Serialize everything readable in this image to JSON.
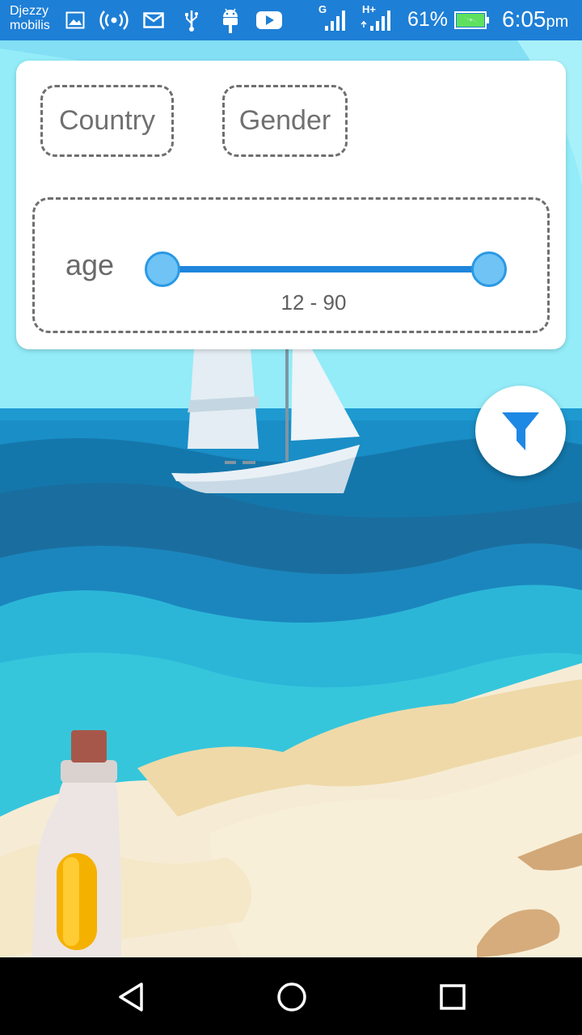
{
  "status_bar": {
    "carrier_line1": "Djezzy",
    "carrier_line2": "mobilis",
    "icons": [
      "image-icon",
      "hotspot-icon",
      "mail-icon",
      "usb-icon",
      "android-icon",
      "youtube-icon",
      "signal-g-icon",
      "signal-hplus-icon",
      "battery-charging-icon"
    ],
    "signal1_label": "G",
    "signal2_label": "H+",
    "battery_percent": "61%",
    "time": "6:05",
    "time_suffix": "pm"
  },
  "filters": {
    "country_label": "Country",
    "gender_label": "Gender",
    "age_label": "age",
    "age_min": 12,
    "age_max": 90,
    "age_range_text": "12 - 90"
  },
  "fab": {
    "icon": "filter-icon",
    "color": "#1e88e5"
  },
  "nav": {
    "icons": [
      "back-icon",
      "home-icon",
      "recents-icon"
    ]
  },
  "colors": {
    "status_bar": "#1e7fd6",
    "accent": "#1f86dc",
    "thumb": "#6fc3f5"
  }
}
